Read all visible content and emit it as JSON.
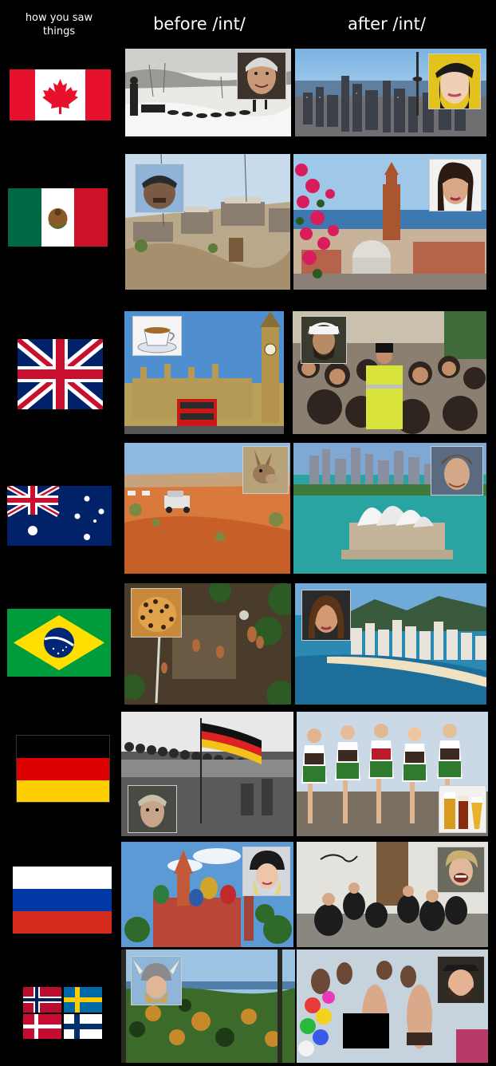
{
  "header": {
    "subtitle": "how you saw things",
    "before_label": "before /int/",
    "after_label": "after /int/"
  },
  "rows": [
    {
      "country": "canada"
    },
    {
      "country": "mexico"
    },
    {
      "country": "united-kingdom"
    },
    {
      "country": "australia"
    },
    {
      "country": "brazil"
    },
    {
      "country": "germany"
    },
    {
      "country": "russia"
    },
    {
      "country": "nordic"
    }
  ],
  "colors": {
    "background": "#000000",
    "canada_red": "#e8112d",
    "mexico_green": "#006847",
    "uk_blue": "#012169",
    "brazil_green": "#009b3a",
    "brazil_yellow": "#fedf00",
    "germany_red": "#dd0000",
    "germany_gold": "#ffce00",
    "russia_blue": "#0039a6"
  }
}
